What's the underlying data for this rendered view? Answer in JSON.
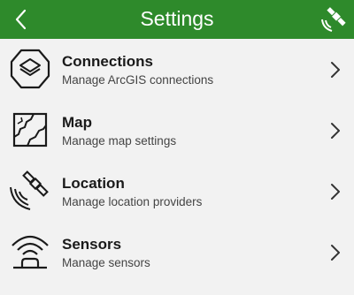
{
  "header": {
    "title": "Settings",
    "back_icon": "chevron-left-icon",
    "right_icon": "satellite-icon",
    "background": "#2e8a2b"
  },
  "items": [
    {
      "label": "Connections",
      "description": "Manage ArcGIS connections",
      "icon": "layers-icon"
    },
    {
      "label": "Map",
      "description": "Manage map settings",
      "icon": "map-icon"
    },
    {
      "label": "Location",
      "description": "Manage location providers",
      "icon": "satellite-icon"
    },
    {
      "label": "Sensors",
      "description": "Manage sensors",
      "icon": "sensor-icon"
    }
  ]
}
